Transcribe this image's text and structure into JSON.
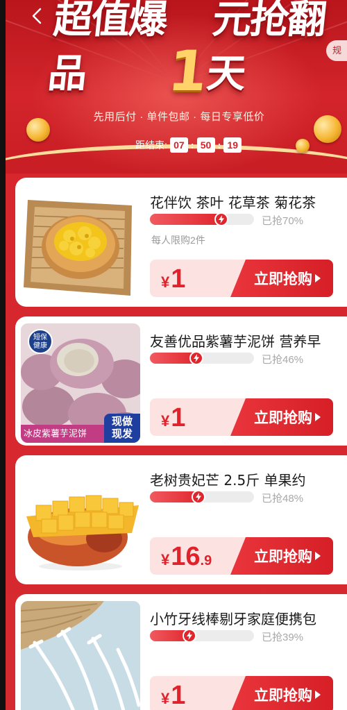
{
  "banner": {
    "headline_a": "超值爆品",
    "headline_num": "1",
    "headline_b": "元抢翻天",
    "subtitle": "先用后付 · 单件包邮 · 每日专享低价",
    "rule_tab": "规",
    "countdown": {
      "label": "距结束:",
      "hours": "07",
      "minutes": "50",
      "seconds": "19"
    }
  },
  "products": [
    {
      "title": "花伴饮 茶叶 花草茶 菊花茶",
      "sold_text": "已抢70%",
      "progress": 0.7,
      "limit_text": "每人限购2件",
      "currency": "¥",
      "price_int": "1",
      "price_dec": "",
      "button_label": "立即抢购"
    },
    {
      "title": "友善优品紫薯芋泥饼 营养早",
      "sold_text": "已抢46%",
      "progress": 0.46,
      "badge": "短保健康",
      "badge_l1": "短保",
      "badge_l2": "健康",
      "image_caption": "冰皮紫薯芋泥饼",
      "image_tag_l1": "现做",
      "image_tag_l2": "现发",
      "currency": "¥",
      "price_int": "1",
      "price_dec": "",
      "button_label": "立即抢购"
    },
    {
      "title": "老树贵妃芒 2.5斤 单果约",
      "sold_text": "已抢48%",
      "progress": 0.48,
      "currency": "¥",
      "price_int": "16",
      "price_dec": ".9",
      "button_label": "立即抢购"
    },
    {
      "title": "小竹牙线棒剔牙家庭便携包",
      "sold_text": "已抢39%",
      "progress": 0.39,
      "currency": "¥",
      "price_int": "1",
      "price_dec": "",
      "button_label": "立即抢购"
    }
  ],
  "colors": {
    "brand_red": "#d8262d",
    "price_red": "#e2222b",
    "buy_bar_bg": "#fde2e2"
  }
}
